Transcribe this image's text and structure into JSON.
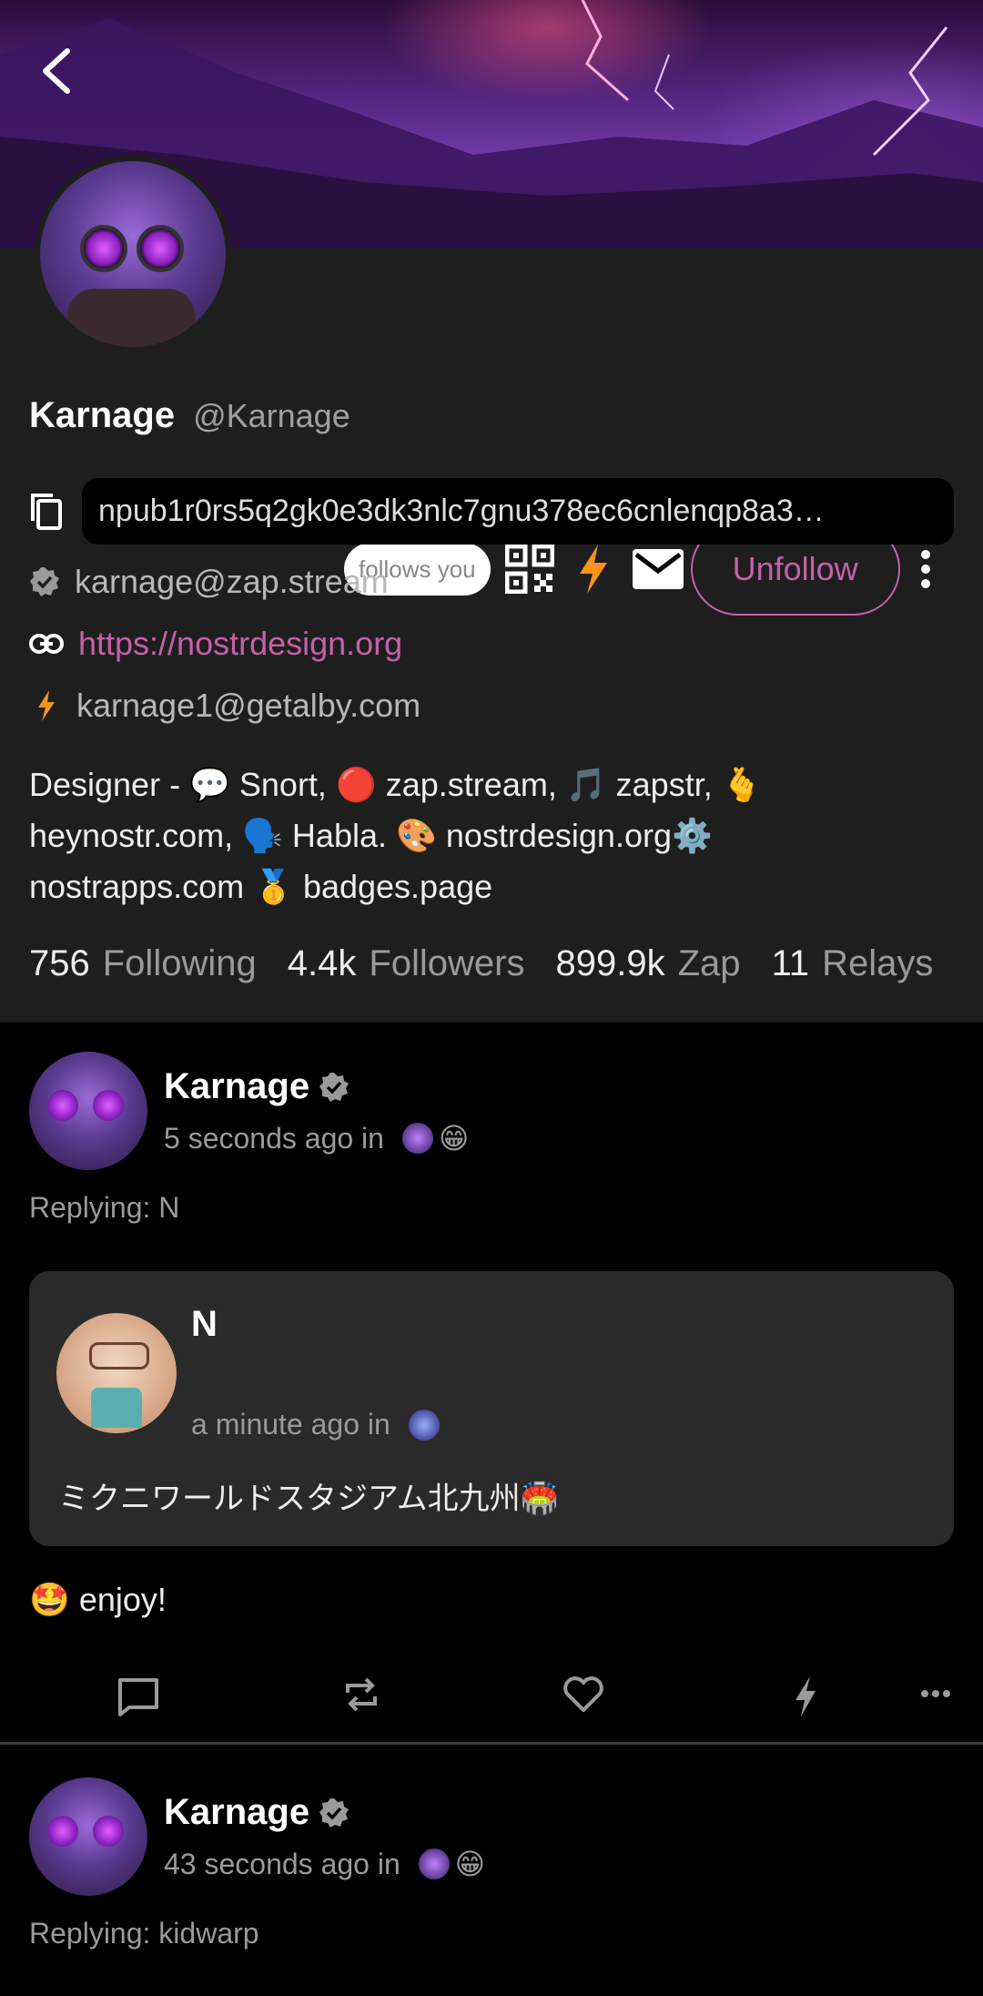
{
  "colors": {
    "accent": "#c760a8",
    "zap": "#f7931a",
    "background": "#000000",
    "card": "#1e1e1e"
  },
  "profile": {
    "follows_you": "follows you",
    "unfollow_label": "Unfollow",
    "display_name": "Karnage",
    "handle": "@Karnage",
    "npub": "npub1r0rs5q2gk0e3dk3nlc7gnu378ec6cnlenqp8a3…",
    "nip05": "karnage@zap.stream",
    "website": "https://nostrdesign.org",
    "lud16": "karnage1@getalby.com",
    "bio_line1": "Designer - 💬 Snort, 🔴 zap.stream, 🎵 zapstr, 🫰",
    "bio_line2": "heynostr.com, 🗣️ Habla. 🎨 nostrdesign.org⚙️",
    "bio_line3": "nostrapps.com 🥇 badges.page",
    "stats": {
      "following_count": "756",
      "following_label": "Following",
      "followers_count": "4.4k",
      "followers_label": "Followers",
      "zap_count": "899.9k",
      "zap_label": "Zap",
      "relays_count": "11",
      "relays_label": "Relays"
    }
  },
  "notes": [
    {
      "author": "Karnage",
      "time": "5 seconds ago in",
      "replying": "Replying: N",
      "quote": {
        "author": "N",
        "time": "a minute ago in",
        "content": "ミクニワールドスタジアム北九州🏟️"
      },
      "content": "🤩 enjoy!"
    },
    {
      "author": "Karnage",
      "time": "43 seconds ago in",
      "replying": "Replying: kidwarp"
    }
  ]
}
